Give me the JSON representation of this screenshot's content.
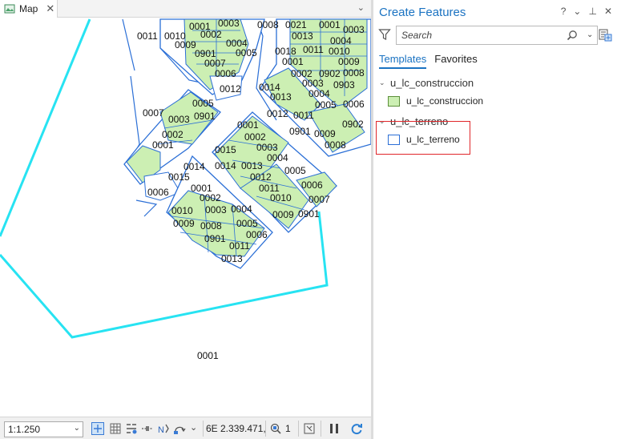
{
  "map": {
    "tab_label": "Map",
    "close_glyph": "✕",
    "menu_glyph": "⌄",
    "labels": {
      "l1": "0001",
      "l2": "0003",
      "l3": "0008",
      "l4": "0021",
      "l5": "0001",
      "l6": "0003",
      "l7": "0011",
      "l8": "0010",
      "l9": "0002",
      "l10": "0013",
      "l11": "0004",
      "l12": "0009",
      "l13": "0004",
      "l14": "0018",
      "l15": "0011",
      "l16": "0010",
      "l17": "0901",
      "l18": "0005",
      "l19": "0001",
      "l20": "0009",
      "l21": "0007",
      "l22": "0008",
      "l23": "0006",
      "l24": "0002",
      "l25": "0902",
      "l26": "0012",
      "l27": "0014",
      "l28": "0003",
      "l29": "0903",
      "l30": "0004",
      "l31": "0013",
      "l32": "0005",
      "l33": "0006",
      "l34": "0005",
      "l35": "0007",
      "l36": "0003",
      "l37": "0901",
      "l38": "0012",
      "l39": "0011",
      "l40": "0902",
      "l41": "0001",
      "l42": "0002",
      "l43": "0901",
      "l44": "0009",
      "l45": "0001",
      "l46": "0002",
      "l47": "0015",
      "l48": "0003",
      "l49": "0008",
      "l50": "0004",
      "l51": "0014",
      "l52": "0014",
      "l53": "0013",
      "l54": "0005",
      "l55": "0015",
      "l56": "0012",
      "l57": "0006",
      "l58": "0001",
      "l59": "0011",
      "l60": "0010",
      "l61": "0007",
      "l62": "0002",
      "l63": "0009",
      "l64": "0901",
      "l65": "0006",
      "l66": "0010",
      "l67": "0003",
      "l68": "0004",
      "l69": "0009",
      "l70": "0008",
      "l71": "0005",
      "l72": "0006",
      "l73": "0901",
      "l74": "0011",
      "l75": "0013",
      "l76": "0001"
    }
  },
  "status": {
    "scale": "1:1.250",
    "coordinates": "6E 2.339.471,",
    "selected_count": "1"
  },
  "create_features": {
    "title": "Create Features",
    "controls": {
      "help": "?",
      "menu": "⌄",
      "pin": "⊥",
      "close": "✕"
    },
    "search_placeholder": "Search",
    "tabs": {
      "templates": "Templates",
      "favorites": "Favorites"
    },
    "groups": {
      "construccion": {
        "header": "u_lc_construccion",
        "item": "u_lc_construccion"
      },
      "terreno": {
        "header": "u_lc_terreno",
        "item": "u_lc_terreno"
      }
    }
  },
  "colors": {
    "accent": "#1b73c2",
    "parcel_fill": "#ccefb3",
    "parcel_outline": "#2b6fd6",
    "boundary": "#27e3f2",
    "highlight": "#e0262a"
  }
}
